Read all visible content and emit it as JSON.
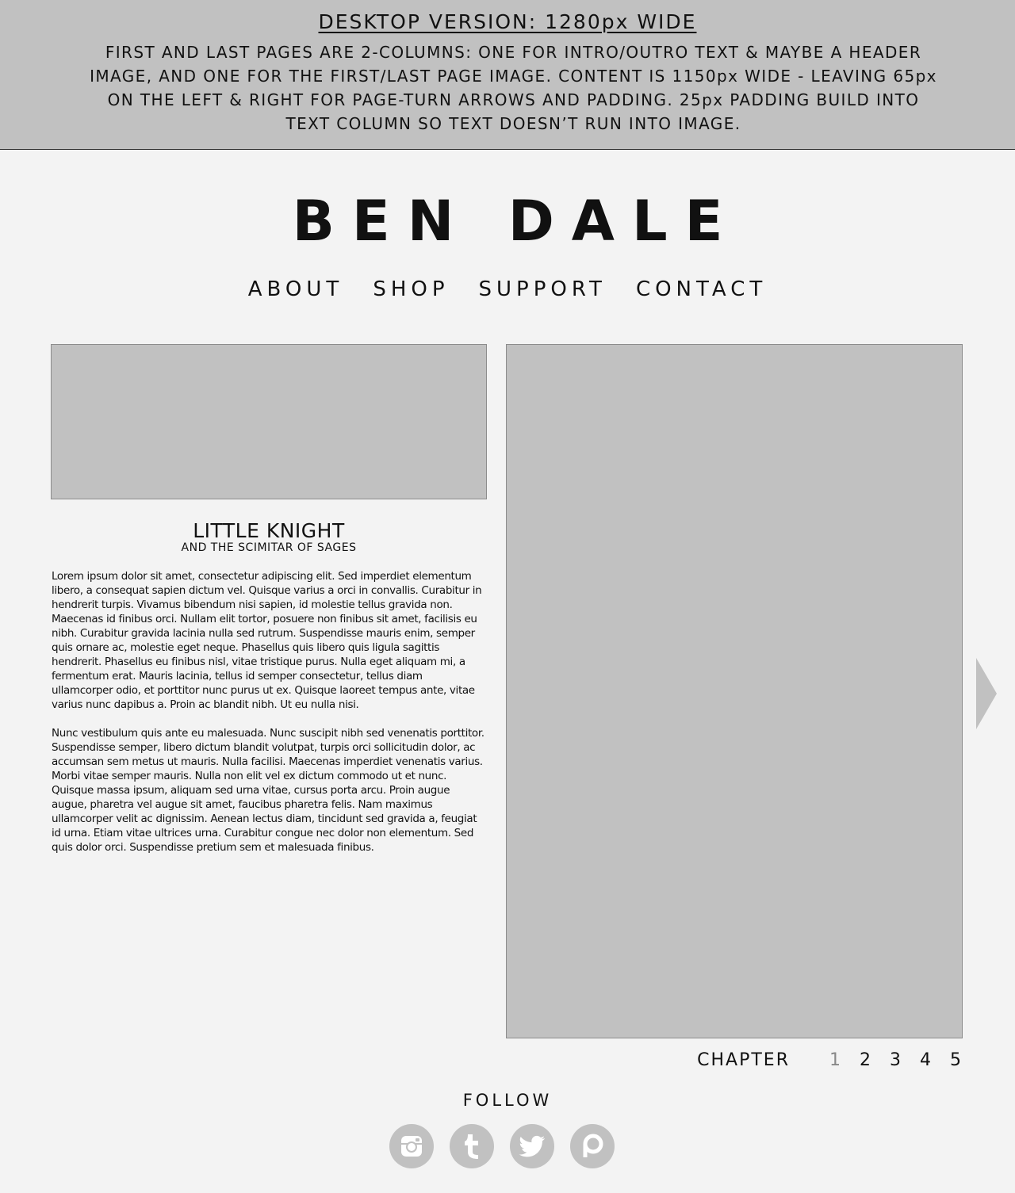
{
  "annotation": {
    "title": "DESKTOP VERSION: 1280px WIDE",
    "body": "FIRST AND LAST PAGES ARE 2-COLUMNS: ONE FOR INTRO/OUTRO TEXT & MAYBE A HEADER IMAGE, AND ONE FOR THE FIRST/LAST PAGE IMAGE. CONTENT IS 1150px WIDE - LEAVING 65px ON THE LEFT & RIGHT FOR PAGE-TURN ARROWS AND PADDING. 25px PADDING BUILD INTO TEXT COLUMN SO TEXT DOESN’T RUN INTO IMAGE."
  },
  "site": {
    "logo": "BEN DALE"
  },
  "nav": {
    "items": [
      "ABOUT",
      "SHOP",
      "SUPPORT",
      "CONTACT"
    ]
  },
  "story": {
    "title": "LITTLE KNIGHT",
    "subtitle": "AND THE SCIMITAR OF SAGES",
    "paragraphs": [
      "Lorem ipsum dolor sit amet, consectetur adipiscing elit. Sed imperdiet elementum libero, a consequat sapien dictum vel. Quisque varius a orci in convallis. Curabitur in hendrerit turpis. Vivamus bibendum nisi sapien, id molestie tellus gravida non. Maecenas id finibus orci. Nullam elit tortor, posuere non finibus sit amet, facilisis eu nibh. Curabitur gravida lacinia nulla sed rutrum. Suspendisse mauris enim, semper quis ornare ac, molestie eget neque. Phasellus quis libero quis ligula sagittis hendrerit. Phasellus eu finibus nisl, vitae tristique purus. Nulla eget aliquam mi, a fermentum erat. Mauris lacinia, tellus id semper consectetur, tellus diam ullamcorper odio, et porttitor nunc purus ut ex. Quisque laoreet tempus ante, vitae varius nunc dapibus a. Proin ac blandit nibh. Ut eu nulla nisi.",
      "Nunc vestibulum quis ante eu malesuada. Nunc suscipit nibh sed venenatis porttitor. Suspendisse semper, libero dictum blandit volutpat, turpis orci sollicitudin dolor, ac accumsan sem metus ut mauris. Nulla facilisi. Maecenas imperdiet venenatis varius. Morbi vitae semper mauris. Nulla non elit vel ex dictum commodo ut et nunc. Quisque massa ipsum, aliquam sed urna vitae, cursus porta arcu. Proin augue augue, pharetra vel augue sit amet, faucibus pharetra felis. Nam maximus ullamcorper velit ac dignissim. Aenean lectus diam, tincidunt sed gravida a, feugiat id urna. Etiam vitae ultrices urna. Curabitur congue nec dolor non elementum. Sed quis dolor orci. Suspendisse pretium sem et malesuada finibus."
    ]
  },
  "chapters": {
    "label": "CHAPTER",
    "numbers": [
      "1",
      "2",
      "3",
      "4",
      "5"
    ],
    "current": "1"
  },
  "footer": {
    "follow_label": "FOLLOW",
    "social_icons": [
      "instagram-icon",
      "tumblr-icon",
      "twitter-icon",
      "patreon-icon"
    ]
  },
  "colors": {
    "background": "#f3f3f3",
    "placeholder_gray": "#c1c1c1",
    "text": "#111111",
    "current_chapter": "#888888"
  }
}
